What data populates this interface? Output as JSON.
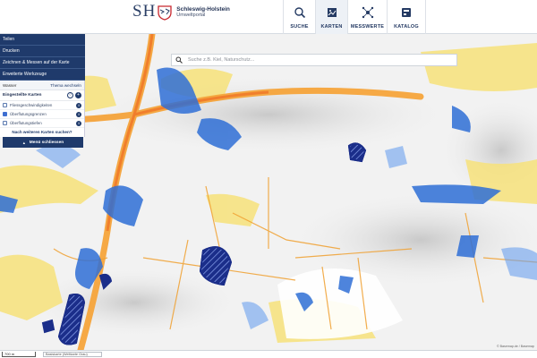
{
  "header": {
    "logo_abbrev": "SH",
    "logo_title": "Schleswig-Holstein",
    "logo_subtitle": "Umweltportal",
    "nav": [
      {
        "label": "SUCHE",
        "icon": "search-icon"
      },
      {
        "label": "KARTEN",
        "icon": "map-layers-icon"
      },
      {
        "label": "MESSWERTE",
        "icon": "sensor-network-icon"
      },
      {
        "label": "KATALOG",
        "icon": "catalog-icon"
      }
    ]
  },
  "search": {
    "placeholder": "Suche z.B. Kiel, Naturschutz..."
  },
  "sidebar": {
    "menu": [
      "Teilen",
      "Drucken",
      "Zeichnen & Messen auf der Karte",
      "Erweiterte Werkzeuge"
    ],
    "theme": {
      "label": "Wasser",
      "switch_label": "Thema wechseln"
    },
    "section_title": "Eingestellte Karten",
    "layers": [
      {
        "label": "Fliessgeschwindigkeiten",
        "checked": false
      },
      {
        "label": "Überflutungsgrenzen",
        "checked": true
      },
      {
        "label": "Überflutungstiefen",
        "checked": false
      }
    ],
    "more_maps": "Nach weiteren Karten suchen?",
    "close_label": "Menü schliessen"
  },
  "bottom": {
    "scale_label": "700 m",
    "basemap_label": "Basiskarte (Weltkarte Grau)",
    "attribution": "© Basemap.de / Basemap"
  },
  "colors": {
    "primary": "#1f3a6b",
    "flood_yellow": "#f7e27a",
    "flood_orange": "#f5a43b",
    "flood_blue": "#2f6fd6",
    "flood_navy": "#1b2e8a"
  }
}
